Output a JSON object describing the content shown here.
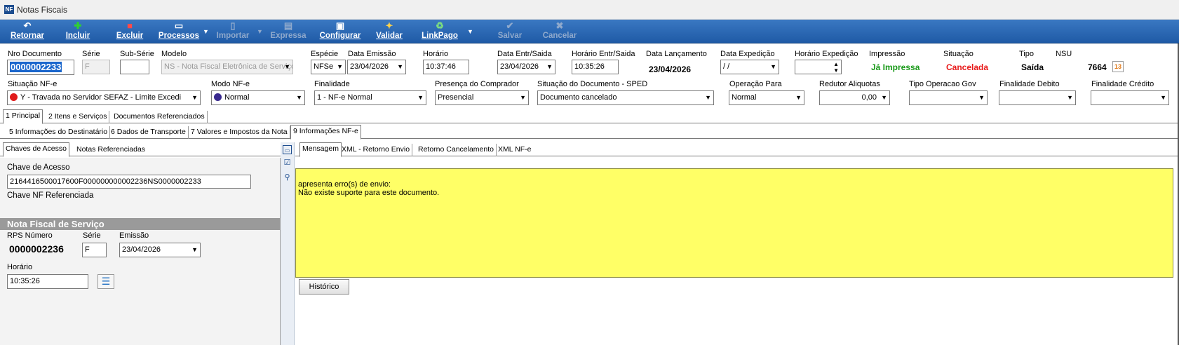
{
  "window": {
    "title": "Notas Fiscais",
    "app_icon": "app-icon"
  },
  "toolbar": {
    "retornar": "Retornar",
    "incluir": "Incluir",
    "excluir": "Excluir",
    "processos": "Processos",
    "importar": "Importar",
    "expressa": "Expressa",
    "configurar": "Configurar",
    "validar": "Validar",
    "linkpago": "LinkPago",
    "salvar": "Salvar",
    "cancelar": "Cancelar"
  },
  "header": {
    "nro_documento": {
      "label": "Nro Documento",
      "value": "0000002233"
    },
    "serie": {
      "label": "Série",
      "value": "F"
    },
    "sub_serie": {
      "label": "Sub-Série",
      "value": ""
    },
    "modelo": {
      "label": "Modelo",
      "value": "NS - Nota Fiscal Eletrônica de Serviço"
    },
    "especie": {
      "label": "Espécie",
      "value": "NFSe"
    },
    "data_emissao": {
      "label": "Data Emissão",
      "value": "23/04/2026"
    },
    "horario": {
      "label": "Horário",
      "value": "10:37:46"
    },
    "data_entr_saida": {
      "label": "Data Entr/Saida",
      "value": "23/04/2026"
    },
    "horario_entr_saida": {
      "label": "Horário Entr/Saida",
      "value": "10:35:26"
    },
    "data_lancamento": {
      "label": "Data Lançamento",
      "value": "23/04/2026"
    },
    "data_expedicao": {
      "label": "Data Expedição",
      "value": " / /"
    },
    "horario_expedicao": {
      "label": "Horário Expedição",
      "value": ""
    },
    "impressao": {
      "label": "Impressão",
      "value": "Já Impressa"
    },
    "situacao": {
      "label": "Situação",
      "value": "Cancelada"
    },
    "tipo": {
      "label": "Tipo",
      "value": "Saída"
    },
    "nsu": {
      "label": "NSU",
      "value": "7664"
    }
  },
  "row2": {
    "situacao_nfe": {
      "label": "Situação NF-e",
      "value": "Y - Travada no Servidor SEFAZ - Limite Excedi"
    },
    "modo_nfe": {
      "label": "Modo NF-e",
      "value": "Normal"
    },
    "finalidade": {
      "label": "Finalidade",
      "value": "1 - NF-e Normal"
    },
    "presenca": {
      "label": "Presença do Comprador",
      "value": "Presencial"
    },
    "situacao_doc": {
      "label": "Situação do Documento - SPED",
      "value": "Documento cancelado"
    },
    "operacao_para": {
      "label": "Operação Para",
      "value": "Normal"
    },
    "redutor": {
      "label": "Redutor Aliquotas",
      "value": "0,00"
    },
    "tipo_operacao_gov": {
      "label": "Tipo Operacao Gov",
      "value": ""
    },
    "finalidade_debito": {
      "label": "Finalidade Debito",
      "value": ""
    },
    "finalidade_credito": {
      "label": "Finalidade Crédito",
      "value": ""
    }
  },
  "tabs1": [
    "1 Principal",
    "2 Itens e Serviços",
    "Documentos Referenciados"
  ],
  "tabs2": [
    "5 Informações do Destinatário",
    "6 Dados de Transporte",
    "7 Valores e Impostos da Nota",
    "9 Informações NF-e"
  ],
  "left_tabs": [
    "Chaves de Acesso",
    "Notas Referenciadas"
  ],
  "right_tabs": [
    "Mensagem",
    "XML - Retorno Envio",
    "Retorno Cancelamento",
    "XML NF-e"
  ],
  "chaves": {
    "chave_label": "Chave de Acesso",
    "chave_value": "2164416500017600F000000000002236NS0000002233",
    "ref_label": "Chave NF Referenciada"
  },
  "nfs": {
    "header": "Nota Fiscal de Serviço",
    "rps_label": "RPS Número",
    "rps_value": "0000002236",
    "serie_label": "Série",
    "serie_value": "F",
    "emissao_label": "Emissão",
    "emissao_value": "23/04/2026",
    "horario_label": "Horário",
    "horario_value": "10:35:26"
  },
  "mensagem": {
    "line1": "apresenta erro(s) de envio:",
    "line2": "Não existe suporte para este documento."
  },
  "historico_button": "Histórico",
  "colors": {
    "toolbar": "#2a66b3",
    "impressa": "#1a9a1a",
    "cancelada": "#e81a1a",
    "msg_bg": "#ffff66"
  }
}
